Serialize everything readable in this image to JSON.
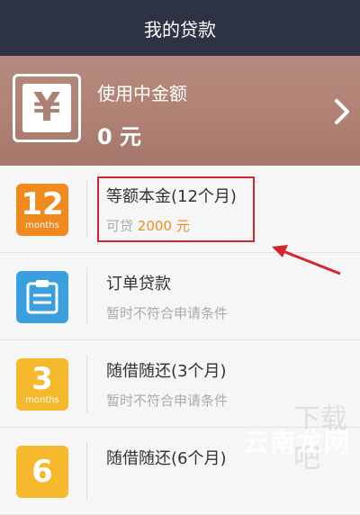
{
  "header": {
    "title": "我的贷款"
  },
  "summary": {
    "label": "使用中金额",
    "amount": "0 元",
    "icon": "yen-icon"
  },
  "loans": [
    {
      "title": "等额本金(12个月)",
      "sub_prefix": "可贷 ",
      "sub_amount": "2000 元",
      "icon_number": "12",
      "icon_caption": "months",
      "icon_color": "#f08a1e",
      "highlighted": true
    },
    {
      "title": "订单贷款",
      "sub": "暂时不符合申请条件",
      "icon": "clipboard-icon",
      "icon_color": "#3aa0dd"
    },
    {
      "title": "随借随还(3个月)",
      "sub": "暂时不符合申请条件",
      "icon_number": "3",
      "icon_caption": "months",
      "icon_color": "#f6b82c"
    },
    {
      "title": "随借随还(6个月)",
      "icon_number": "6",
      "icon_color": "#f6b82c"
    }
  ],
  "watermark": {
    "text": "云南龙网",
    "text2": "下载吧"
  },
  "colors": {
    "header_bg": "#2d3343",
    "hero_bg": "#b08274",
    "accent_orange": "#f08c1f",
    "annotation_red": "#d3272f"
  }
}
